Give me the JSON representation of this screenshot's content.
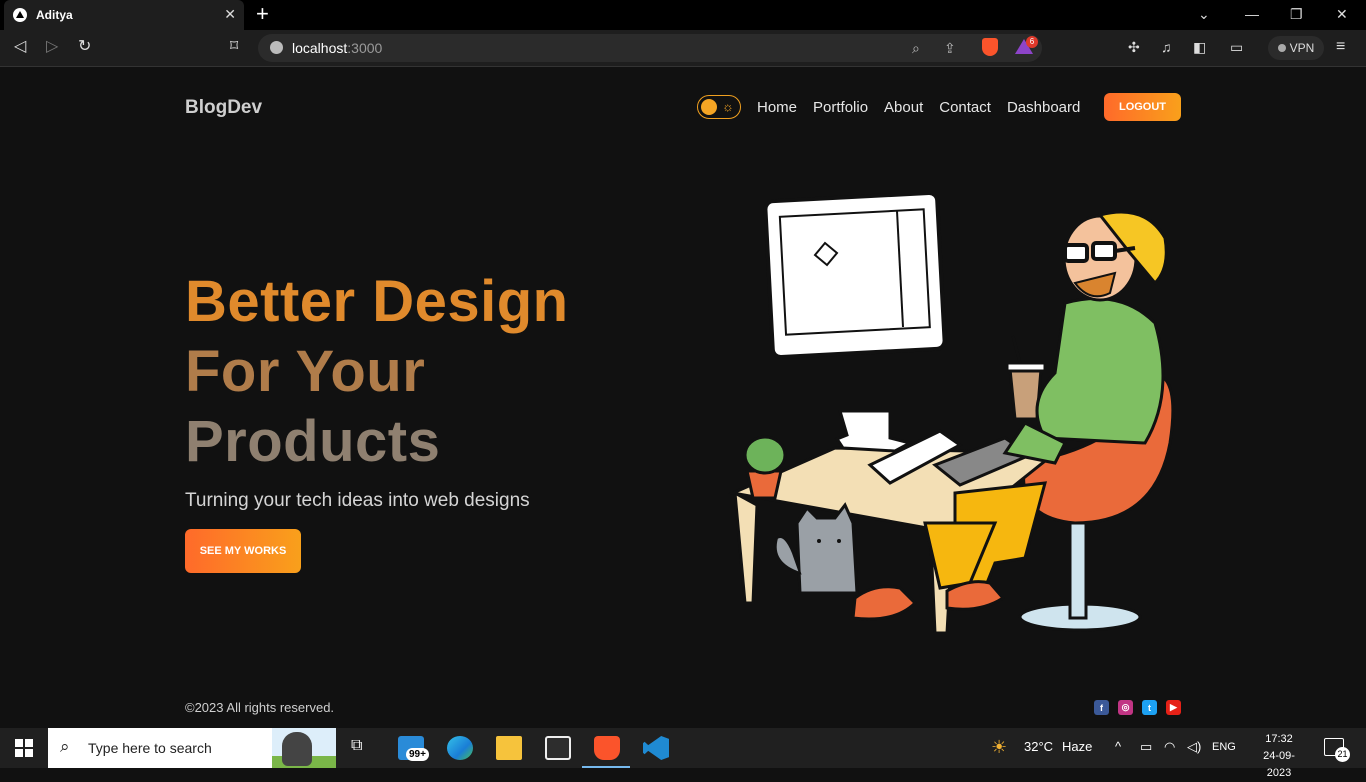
{
  "browser": {
    "tab_title": "Aditya",
    "url_host": "localhost",
    "url_port": ":3000",
    "rewards_badge": "6",
    "vpn_label": "VPN"
  },
  "site": {
    "brand": "BlogDev",
    "nav": [
      "Home",
      "Portfolio",
      "About",
      "Contact",
      "Dashboard"
    ],
    "logout_label": "LOGOUT",
    "hero": {
      "line1": "Better Design",
      "line2": "For Your",
      "line3": "Products",
      "subtitle": "Turning your tech ideas into web designs",
      "cta_label": "SEE MY WORKS"
    },
    "footer": {
      "copyright": "©2023 All rights reserved."
    },
    "colors": {
      "accent": "#f58220",
      "background": "#111111",
      "title_orange": "#e08a2c"
    }
  },
  "taskbar": {
    "search_placeholder": "Type here to search",
    "mail_badge": "99+",
    "weather_temp": "32°C",
    "weather_text": "Haze",
    "language": "ENG",
    "time": "17:32",
    "date": "24-09-2023",
    "notifications": "21"
  }
}
